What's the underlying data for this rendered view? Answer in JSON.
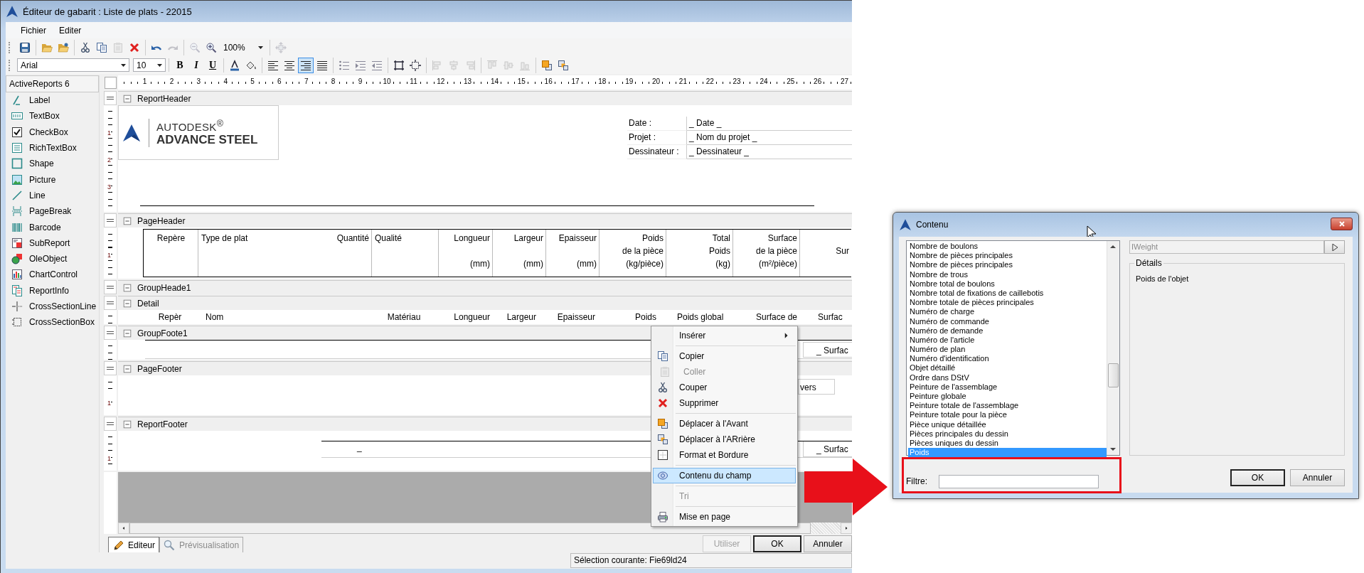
{
  "window": {
    "title": "Éditeur de gabarit : Liste de plats - 22015"
  },
  "menu": [
    "Fichier",
    "Editer"
  ],
  "standard_toolbar": {
    "buttons": [
      {
        "disabled": false
      },
      {
        "disabled": false
      },
      {
        "disabled": false
      },
      {
        "disabled": false
      },
      {
        "disabled": false
      },
      {
        "disabled": true
      },
      {
        "disabled": false
      },
      {
        "disabled": false
      },
      {
        "disabled": true
      },
      {
        "disabled": true
      },
      {
        "disabled": false
      },
      {
        "disabled": true
      }
    ],
    "zoom": "100%"
  },
  "format_toolbar": {
    "font": "Arial",
    "size": "10",
    "style_buttons": [
      "B",
      "I",
      "U"
    ],
    "alignment": [
      {
        "selected": false
      },
      {
        "selected": false
      },
      {
        "selected": true
      },
      {
        "selected": false
      }
    ],
    "layout_buttons": [
      {
        "disabled": false
      },
      {
        "disabled": false
      },
      {
        "disabled": true
      },
      {
        "disabled": true
      },
      {
        "disabled": true
      },
      {
        "disabled": true
      },
      {
        "disabled": true
      },
      {
        "disabled": true
      },
      {
        "disabled": false
      },
      {
        "disabled": false
      }
    ]
  },
  "toolbox": {
    "title": "ActiveReports 6",
    "items": [
      "Label",
      "TextBox",
      "CheckBox",
      "RichTextBox",
      "Shape",
      "Picture",
      "Line",
      "PageBreak",
      "Barcode",
      "SubReport",
      "OleObject",
      "ChartControl",
      "ReportInfo",
      "CrossSectionLine",
      "CrossSectionBox"
    ]
  },
  "ruler": [
    "1",
    "2",
    "3",
    "4",
    "5",
    "6",
    "7",
    "8",
    "9",
    "10",
    "11",
    "12",
    "13",
    "14",
    "15",
    "16",
    "17",
    "18",
    "19",
    "20",
    "21",
    "22",
    "23",
    "24",
    "25",
    "26",
    "27"
  ],
  "sections": [
    {
      "kind": "report_header",
      "name": "ReportHeader",
      "expanded": true,
      "ruler_marks": [
        "1",
        "2",
        "3"
      ],
      "logo": {
        "line1": "AUTODESK$^{®}$",
        "line2": "ADVANCE STEEL"
      },
      "fields": [
        {
          "label": "Date :",
          "value": "_ Date _"
        },
        {
          "label": "Projet :",
          "value": "_ Nom du projet _"
        },
        {
          "label": "Dessinateur :",
          "value": "_ Dessinateur _"
        }
      ]
    },
    {
      "kind": "page_header",
      "name": "PageHeader",
      "expanded": true,
      "ruler_marks": [
        "1"
      ],
      "columns": [
        {
          "title": "Repère"
        },
        {
          "title": "Type de plat"
        },
        {
          "title": "Quantité"
        },
        {
          "title": "Qualité"
        },
        {
          "title": "Longueur",
          "unit": "(mm)"
        },
        {
          "title": "Largeur",
          "unit": "(mm)"
        },
        {
          "title": "Epaisseur",
          "unit": "(mm)"
        },
        {
          "title": "Poids",
          "subtitle": "de la pièce",
          "unit": "(kg/pièce)"
        },
        {
          "title": "Total",
          "subtitle": "Poids",
          "unit": "(kg)"
        },
        {
          "title": "Surface",
          "subtitle": "de la pièce",
          "unit": "(m²/pièce)"
        },
        {
          "subtitle": "Sur"
        }
      ]
    },
    {
      "kind": "group_header",
      "name": "GroupHeade1",
      "expanded": true
    },
    {
      "kind": "detail",
      "name": "Detail",
      "expanded": true,
      "cells": [
        "Repèr",
        "Nom",
        "Matériau",
        "Longueur",
        "Largeur",
        "Epaisseur",
        "Poids",
        "Poids global",
        "Surface de",
        "Surfac"
      ]
    },
    {
      "kind": "group_footer",
      "name": "GroupFoote1",
      "expanded": true,
      "field": "_ Surfac"
    },
    {
      "kind": "page_footer",
      "name": "PageFooter",
      "expanded": true,
      "ruler_marks": [
        "1"
      ],
      "field": "vers"
    },
    {
      "kind": "report_footer",
      "name": "ReportFooter",
      "expanded": true,
      "ruler_marks": [
        "1"
      ],
      "mark": "_",
      "field": "_ Surfac"
    }
  ],
  "tabs": [
    {
      "label": "Editeur",
      "selected": true
    },
    {
      "label": "Prévisualisation",
      "selected": false
    }
  ],
  "buttons": [
    {
      "label": "Utiliser",
      "disabled": true,
      "default": false
    },
    {
      "label": "OK",
      "disabled": false,
      "default": true
    },
    {
      "label": "Annuler",
      "disabled": false,
      "default": false
    }
  ],
  "status_bar": "Sélection courante: Fie69ld24",
  "context_menu": {
    "items": [
      {
        "kind": "submenu",
        "label": "Insérer",
        "disabled": false,
        "selected": false
      },
      {
        "kind": "separator"
      },
      {
        "kind": "item",
        "label": "Copier",
        "disabled": false,
        "selected": false
      },
      {
        "kind": "item",
        "label": "Coller",
        "disabled": true,
        "selected": false
      },
      {
        "kind": "item",
        "label": "Couper",
        "disabled": false,
        "selected": false
      },
      {
        "kind": "item",
        "label": "Supprimer",
        "disabled": false,
        "selected": false
      },
      {
        "kind": "separator"
      },
      {
        "kind": "item",
        "label": "Déplacer à l'Avant",
        "disabled": false,
        "selected": false
      },
      {
        "kind": "item",
        "label": "Déplacer à l'ARrière",
        "disabled": false,
        "selected": false
      },
      {
        "kind": "item",
        "label": "Format et Bordure",
        "disabled": false,
        "selected": false
      },
      {
        "kind": "separator"
      },
      {
        "kind": "item",
        "label": "Contenu du champ",
        "disabled": false,
        "selected": true
      },
      {
        "kind": "separator"
      },
      {
        "kind": "item",
        "label": "Tri",
        "disabled": true,
        "selected": false
      },
      {
        "kind": "separator"
      },
      {
        "kind": "item",
        "label": "Mise en page",
        "disabled": false,
        "selected": false
      }
    ]
  },
  "dialog": {
    "title": "Contenu",
    "list": [
      {
        "label": "Nombre de boulons",
        "selected": false
      },
      {
        "label": "Nombre de pièces principales",
        "selected": false
      },
      {
        "label": "Nombre de pièces principales",
        "selected": false
      },
      {
        "label": "Nombre de trous",
        "selected": false
      },
      {
        "label": "Nombre total de boulons",
        "selected": false
      },
      {
        "label": "Nombre total de fixations de caillebotis",
        "selected": false
      },
      {
        "label": "Nombre totale de pièces principales",
        "selected": false
      },
      {
        "label": "Numéro de charge",
        "selected": false
      },
      {
        "label": "Numéro de commande",
        "selected": false
      },
      {
        "label": "Numéro de demande",
        "selected": false
      },
      {
        "label": "Numéro de l'article",
        "selected": false
      },
      {
        "label": "Numéro de plan",
        "selected": false
      },
      {
        "label": "Numéro d'identification",
        "selected": false
      },
      {
        "label": "Objet détaillé",
        "selected": false
      },
      {
        "label": "Ordre dans DStV",
        "selected": false
      },
      {
        "label": "Peinture de l'assemblage",
        "selected": false
      },
      {
        "label": "Peinture globale",
        "selected": false
      },
      {
        "label": "Peinture totale de l'assemblage",
        "selected": false
      },
      {
        "label": "Peinture totale pour la pièce",
        "selected": false
      },
      {
        "label": "Pièce unique détaillée",
        "selected": false
      },
      {
        "label": "Pièces principales du dessin",
        "selected": false
      },
      {
        "label": "Pièces uniques du dessin",
        "selected": false
      },
      {
        "label": "Poids",
        "selected": true
      }
    ],
    "expression": {
      "value": "IWeight",
      "disabled": true
    },
    "details_title": "Détails",
    "details": "Poids de l'objet",
    "filter_label": "Filtre:",
    "buttons": [
      {
        "label": "OK",
        "default": true
      },
      {
        "label": "Annuler",
        "default": false
      }
    ]
  }
}
